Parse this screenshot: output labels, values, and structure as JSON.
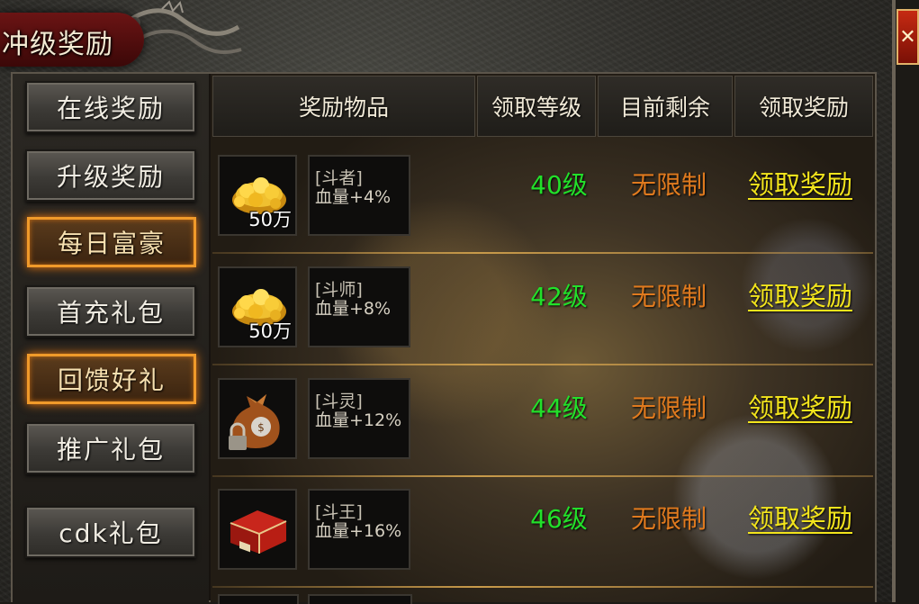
{
  "window": {
    "title": "冲级奖励",
    "close_label": "✕"
  },
  "sidebar": {
    "items": [
      {
        "label": "在线奖励",
        "highlighted": false
      },
      {
        "label": "升级奖励",
        "highlighted": false
      },
      {
        "label": "每日富豪",
        "highlighted": true
      },
      {
        "label": "首充礼包",
        "highlighted": false
      },
      {
        "label": "回馈好礼",
        "highlighted": true
      },
      {
        "label": "推广礼包",
        "highlighted": false
      },
      {
        "label": "cdk礼包",
        "highlighted": false
      }
    ]
  },
  "table": {
    "headers": [
      "奖励物品",
      "领取等级",
      "目前剩余",
      "领取奖励"
    ],
    "rows": [
      {
        "icon": "gold-coins-icon",
        "amount": "50万",
        "rank": "[斗者]",
        "bonus": "血量+4%",
        "level": "40级",
        "remaining": "无限制",
        "action": "领取奖励"
      },
      {
        "icon": "gold-coins-icon",
        "amount": "50万",
        "rank": "[斗师]",
        "bonus": "血量+8%",
        "level": "42级",
        "remaining": "无限制",
        "action": "领取奖励"
      },
      {
        "icon": "locked-money-bag-icon",
        "amount": "",
        "rank": "[斗灵]",
        "bonus": "血量+12%",
        "level": "44级",
        "remaining": "无限制",
        "action": "领取奖励"
      },
      {
        "icon": "red-treasure-chest-icon",
        "amount": "",
        "rank": "[斗王]",
        "bonus": "血量+16%",
        "level": "46级",
        "remaining": "无限制",
        "action": "领取奖励"
      }
    ]
  },
  "colors": {
    "level": "#22e02a",
    "remaining": "#e07a1e",
    "claim": "#f2e41c",
    "highlight_border": "#f09a2a"
  }
}
